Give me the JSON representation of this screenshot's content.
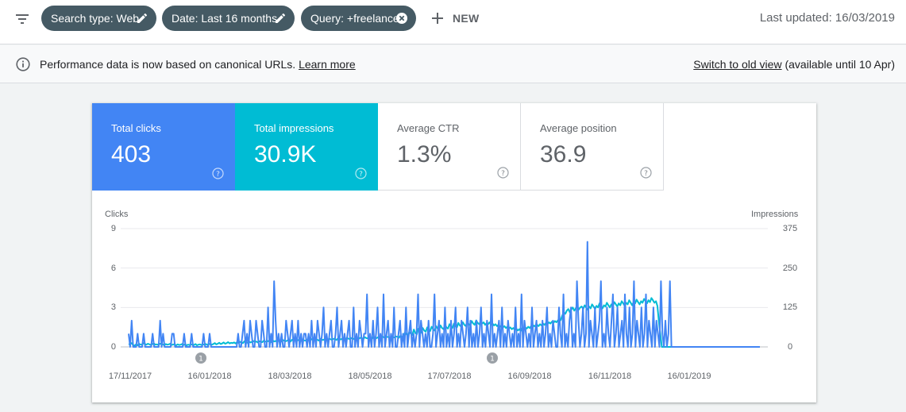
{
  "topbar": {
    "filters": [
      {
        "label": "Search type: Web",
        "icon": "edit-icon"
      },
      {
        "label": "Date: Last 16 months",
        "icon": "edit-icon"
      },
      {
        "label": "Query: +freelance",
        "icon": "close-circle-icon"
      }
    ],
    "new_label": "NEW",
    "last_updated": "Last updated: 16/03/2019"
  },
  "banner": {
    "text": "Performance data is now based on canonical URLs.",
    "learn_more": "Learn more",
    "switch_link": "Switch to old view",
    "available": "(available until 10 Apr)"
  },
  "metrics": [
    {
      "label": "Total clicks",
      "value": "403"
    },
    {
      "label": "Total impressions",
      "value": "30.9K"
    },
    {
      "label": "Average CTR",
      "value": "1.3%"
    },
    {
      "label": "Average position",
      "value": "36.9"
    }
  ],
  "colors": {
    "clicks": "#4285f4",
    "impressions": "#00bcd4",
    "chip": "#455a64"
  },
  "chart_data": {
    "type": "line",
    "ylabel": "Clicks",
    "y2label": "Impressions",
    "yticks": [
      "9",
      "6",
      "3",
      "0"
    ],
    "y2ticks": [
      "375",
      "250",
      "125",
      "0"
    ],
    "ylim": [
      0,
      9
    ],
    "y2lim": [
      0,
      375
    ],
    "xticks": [
      "17/11/2017",
      "16/01/2018",
      "18/03/2018",
      "18/05/2018",
      "17/07/2018",
      "16/09/2018",
      "16/11/2018",
      "16/01/2019"
    ],
    "annotations": [
      "1",
      "1"
    ],
    "series": [
      {
        "name": "Clicks",
        "color": "#4285f4",
        "values": [
          1,
          0,
          2,
          0,
          0,
          0,
          1,
          0,
          0,
          0,
          1,
          0,
          0,
          0,
          0,
          0,
          1,
          0,
          0,
          0,
          0,
          2,
          0,
          1,
          0,
          0,
          0,
          0,
          0,
          1,
          1,
          0,
          0,
          0,
          0,
          0,
          0,
          1,
          0,
          0,
          0,
          0,
          1,
          0,
          0,
          0,
          0,
          0,
          0,
          0,
          1,
          0,
          0,
          0,
          1,
          0,
          0,
          0,
          0,
          0,
          0,
          0,
          0,
          0,
          0,
          0,
          0,
          0,
          0,
          0,
          0,
          0,
          0,
          1,
          0,
          0,
          1,
          2,
          0,
          1,
          0,
          2,
          1,
          0,
          0,
          2,
          1,
          0,
          0,
          2,
          1,
          0,
          0,
          3,
          0,
          1,
          0,
          5,
          2,
          0,
          1,
          0,
          1,
          0,
          0,
          2,
          1,
          0,
          1,
          2,
          0,
          1,
          0,
          2,
          0,
          1,
          0,
          1,
          1,
          0,
          1,
          0,
          2,
          0,
          1,
          0,
          2,
          1,
          0,
          1,
          3,
          0,
          1,
          0,
          1,
          2,
          0,
          0,
          1,
          3,
          0,
          1,
          2,
          0,
          1,
          0,
          1,
          2,
          0,
          0,
          3,
          0,
          1,
          0,
          2,
          1,
          0,
          1,
          1,
          4,
          0,
          1,
          0,
          2,
          0,
          1,
          3,
          0,
          1,
          0,
          4,
          0,
          1,
          2,
          0,
          1,
          0,
          3,
          0,
          0,
          1,
          2,
          0,
          1,
          0,
          3,
          0,
          1,
          2,
          0,
          1,
          0,
          1,
          4,
          0,
          2,
          1,
          0,
          1,
          0,
          2,
          0,
          0,
          1,
          4,
          0,
          1,
          2,
          0,
          1,
          0,
          3,
          0,
          1,
          0,
          2,
          0,
          1,
          3,
          0,
          1,
          0,
          2,
          1,
          0,
          1,
          3,
          0,
          2,
          0,
          1,
          0,
          2,
          0,
          1,
          3,
          0,
          1,
          0,
          2,
          1,
          0,
          4,
          0,
          1,
          0,
          1,
          2,
          0,
          3,
          0,
          1,
          0,
          2,
          1,
          0,
          1,
          0,
          3,
          0,
          1,
          0,
          4,
          0,
          2,
          1,
          0,
          1,
          0,
          3,
          0,
          1,
          2,
          0,
          1,
          0,
          2,
          0,
          1,
          3,
          0,
          1,
          0,
          2,
          1,
          0,
          0,
          3,
          1,
          0,
          4,
          0,
          1,
          0,
          2,
          3,
          0,
          1,
          0,
          5,
          2,
          0,
          1,
          3,
          0,
          1,
          8,
          0,
          2,
          1,
          0,
          3,
          0,
          1,
          2,
          5,
          0,
          1,
          0,
          3,
          1,
          0,
          2,
          4,
          0,
          1,
          3,
          0,
          1,
          2,
          0,
          4,
          1,
          0,
          3,
          0,
          1,
          5,
          0,
          2,
          1,
          0,
          3,
          0,
          1,
          4,
          0,
          2,
          1,
          0,
          3,
          0,
          2,
          1,
          0,
          5,
          1,
          0,
          2,
          0,
          1,
          5,
          0,
          0,
          0,
          0,
          0,
          0,
          0,
          0,
          0,
          0,
          0,
          0,
          0,
          0,
          0,
          0,
          0,
          0,
          0,
          0,
          0,
          0,
          0,
          0,
          0,
          0,
          0,
          0,
          0,
          0,
          0,
          0,
          0,
          0,
          0,
          0,
          0,
          0,
          0,
          0,
          0,
          0,
          0,
          0,
          0,
          0,
          0,
          0,
          0,
          0,
          0,
          0,
          0,
          0,
          0,
          0,
          0,
          0,
          0,
          0
        ]
      },
      {
        "name": "Impressions",
        "color": "#00bcd4",
        "values": [
          8,
          9,
          12,
          6,
          4,
          8,
          5,
          10,
          7,
          8,
          12,
          9,
          7,
          10,
          8,
          6,
          9,
          11,
          7,
          8,
          6,
          10,
          9,
          8,
          5,
          9,
          7,
          8,
          10,
          6,
          8,
          7,
          5,
          8,
          6,
          7,
          9,
          6,
          8,
          5,
          7,
          6,
          8,
          7,
          6,
          9,
          5,
          7,
          8,
          6,
          8,
          7,
          9,
          6,
          10,
          8,
          7,
          9,
          12,
          8,
          10,
          13,
          9,
          11,
          14,
          10,
          12,
          15,
          11,
          13,
          12,
          14,
          11,
          15,
          13,
          16,
          14,
          12,
          18,
          15,
          13,
          17,
          14,
          16,
          19,
          15,
          17,
          14,
          18,
          16,
          15,
          20,
          17,
          16,
          19,
          18,
          15,
          21,
          17,
          19,
          16,
          20,
          18,
          17,
          22,
          19,
          18,
          21,
          20,
          17,
          23,
          19,
          21,
          18,
          22,
          20,
          19,
          24,
          21,
          20,
          23,
          22,
          19,
          25,
          22,
          21,
          24,
          23,
          20,
          26,
          23,
          22,
          25,
          24,
          21,
          27,
          24,
          23,
          26,
          25,
          22,
          28,
          25,
          24,
          27,
          26,
          23,
          29,
          26,
          25,
          28,
          27,
          24,
          30,
          27,
          26,
          29,
          28,
          25,
          31,
          28,
          27,
          30,
          29,
          26,
          32,
          29,
          28,
          31,
          30,
          27,
          33,
          30,
          29,
          32,
          31,
          28,
          34,
          31,
          30,
          33,
          32,
          29,
          35,
          32,
          31,
          45,
          40,
          35,
          48,
          42,
          38,
          55,
          44,
          40,
          58,
          50,
          45,
          60,
          52,
          48,
          62,
          54,
          50,
          64,
          56,
          52,
          66,
          58,
          54,
          68,
          60,
          56,
          70,
          62,
          58,
          72,
          64,
          60,
          74,
          66,
          62,
          76,
          68,
          64,
          78,
          70,
          66,
          80,
          72,
          68,
          82,
          74,
          70,
          84,
          76,
          72,
          80,
          74,
          78,
          70,
          75,
          72,
          78,
          70,
          74,
          68,
          72,
          66,
          70,
          64,
          68,
          62,
          66,
          60,
          64,
          58,
          62,
          56,
          60,
          54,
          58,
          52,
          56,
          50,
          60,
          55,
          62,
          58,
          64,
          60,
          66,
          62,
          68,
          64,
          70,
          66,
          72,
          68,
          74,
          70,
          76,
          72,
          78,
          74,
          80,
          76,
          82,
          78,
          84,
          80,
          86,
          100,
          110,
          105,
          115,
          120,
          110,
          118,
          125,
          115,
          122,
          130,
          118,
          125,
          128,
          120,
          132,
          125,
          118,
          128,
          122,
          135,
          128,
          120,
          130,
          125,
          138,
          130,
          122,
          132,
          128,
          140,
          132,
          125,
          135,
          130,
          142,
          135,
          128,
          138,
          132,
          145,
          138,
          130,
          140,
          135,
          148,
          140,
          132,
          142,
          138,
          150,
          142,
          135,
          145,
          140,
          152,
          145,
          138,
          148,
          142,
          155,
          148,
          140,
          145,
          130,
          80,
          40,
          0,
          0,
          0,
          0,
          0,
          0,
          0,
          0,
          0,
          0,
          0,
          0,
          0,
          0,
          0,
          0,
          0,
          0,
          0,
          0,
          0,
          0,
          0,
          0,
          0,
          0,
          0,
          0,
          0,
          0,
          0,
          0,
          0,
          0,
          0,
          0,
          0,
          0,
          0,
          0,
          0,
          0,
          0,
          0,
          0,
          0,
          0,
          0,
          0,
          0,
          0,
          0,
          0,
          0,
          0,
          0,
          0,
          0,
          0,
          0,
          0,
          0,
          0,
          0,
          0,
          0,
          0
        ]
      }
    ]
  }
}
